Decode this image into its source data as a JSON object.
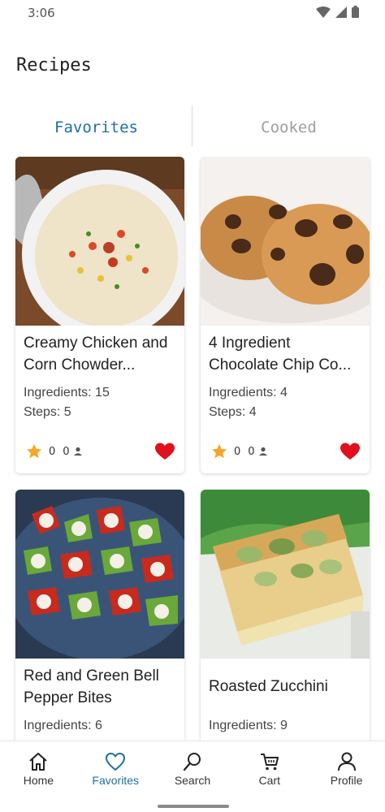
{
  "status_bar": {
    "time": "3:06"
  },
  "header": {
    "title": "Recipes"
  },
  "tabs": [
    {
      "label": "Favorites",
      "active": true
    },
    {
      "label": "Cooked",
      "active": false
    }
  ],
  "recipes": [
    {
      "title": "Creamy Chicken and Corn Chowder...",
      "ingredients": "Ingredients: 15",
      "steps": "Steps: 5",
      "rating": "0",
      "cooked": "0",
      "favorited": true
    },
    {
      "title": "4 Ingredient Chocolate Chip Co...",
      "ingredients": "Ingredients: 4",
      "steps": "Steps: 4",
      "rating": "0",
      "cooked": "0",
      "favorited": true
    },
    {
      "title": "Red and Green Bell Pepper Bites",
      "ingredients": "Ingredients: 6"
    },
    {
      "title": "Roasted Zucchini",
      "ingredients": "Ingredients: 9"
    }
  ],
  "bottom_nav": [
    {
      "label": "Home",
      "icon": "home-icon"
    },
    {
      "label": "Favorites",
      "icon": "heart-icon",
      "active": true
    },
    {
      "label": "Search",
      "icon": "search-icon"
    },
    {
      "label": "Cart",
      "icon": "cart-icon"
    },
    {
      "label": "Profile",
      "icon": "profile-icon"
    }
  ],
  "colors": {
    "accent": "#1c6ea4",
    "star": "#f5a623",
    "heart": "#e0101e",
    "inactive_tab": "#9e9e9e"
  }
}
